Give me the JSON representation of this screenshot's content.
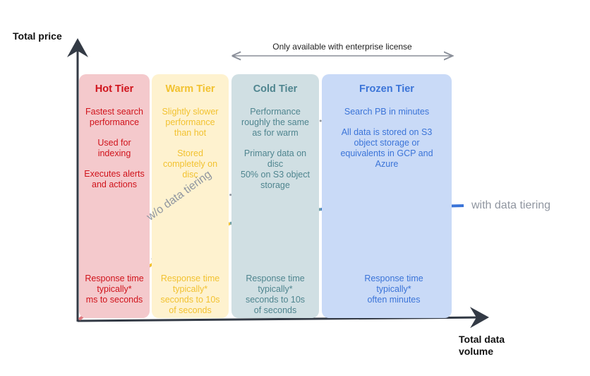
{
  "axes": {
    "y_label": "Total price",
    "x_label_line1": "Total data",
    "x_label_line2": "volume"
  },
  "enterprise_note": "Only available with enterprise license",
  "tiers": [
    {
      "name": "Hot Tier",
      "color": "#d0131b",
      "bg": "#f4c9cc",
      "desc": [
        "Fastest search performance",
        "Used for indexing",
        "Executes alerts and actions"
      ],
      "response": [
        "Response time",
        "typically*",
        "ms to seconds"
      ]
    },
    {
      "name": "Warm Tier",
      "color": "#f2c230",
      "bg": "#fef2cf",
      "desc": [
        "Slightly slower performance than hot",
        "Stored completely on disc"
      ],
      "response": [
        "Response time",
        "typically*",
        "seconds to 10s",
        "of seconds"
      ]
    },
    {
      "name": "Cold Tier",
      "color": "#4f858f",
      "bg": "#d0dfe3",
      "desc": [
        "Performance roughly the same as for warm",
        "Primary data on disc\n50% on S3 object storage"
      ],
      "response": [
        "Response time",
        "typically*",
        "seconds to 10s",
        "of seconds"
      ]
    },
    {
      "name": "Frozen Tier",
      "color": "#3b74d8",
      "bg": "#c9daf7",
      "desc": [
        "Search PB in minutes",
        "All data is stored on S3 object storage or equivalents in GCP and Azure"
      ],
      "response": [
        "Response time",
        "typically*",
        "often minutes"
      ]
    }
  ],
  "lines": {
    "with_tiering": "with data tiering",
    "without_tiering": "w/o data tiering"
  }
}
